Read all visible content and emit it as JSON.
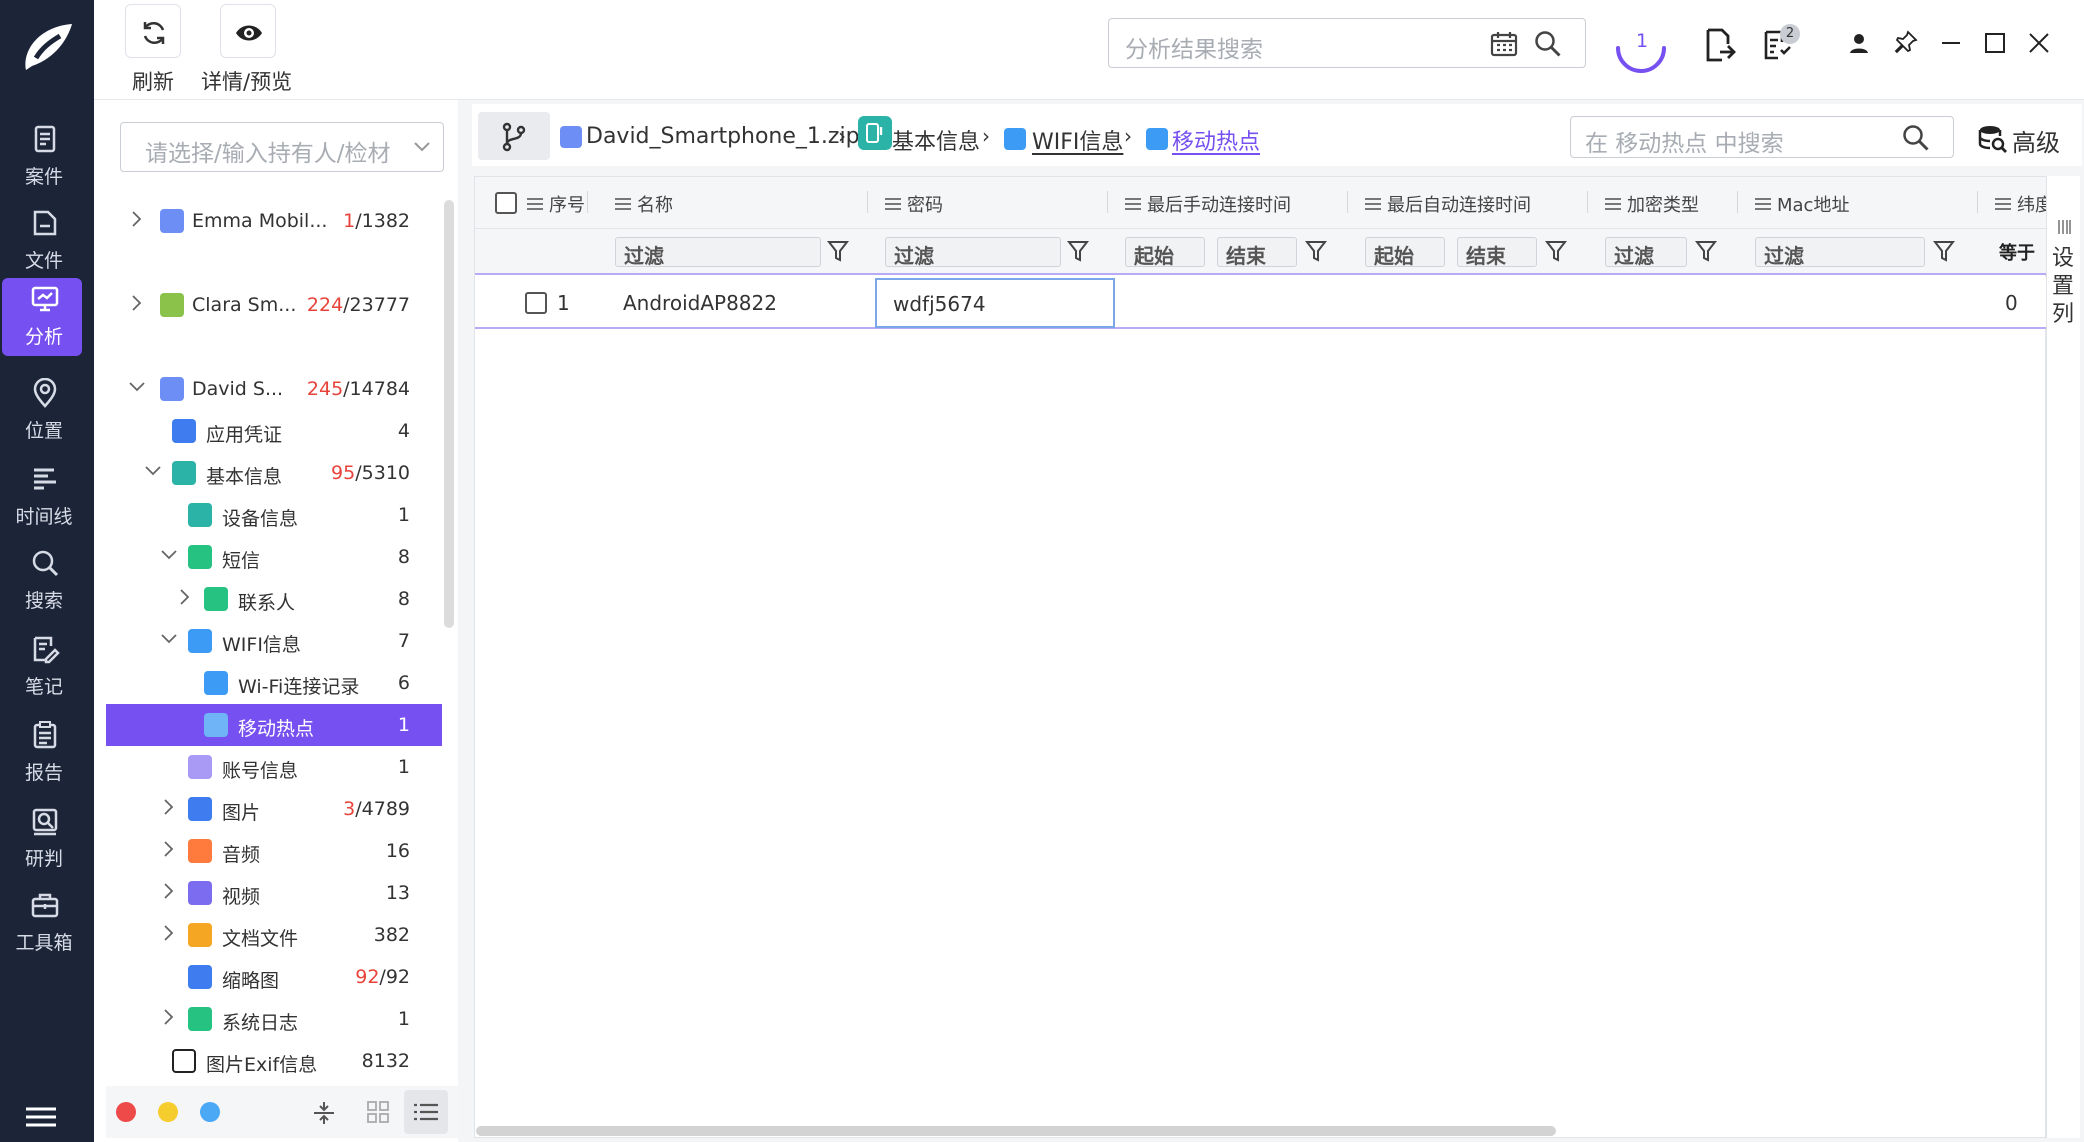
{
  "toolbar": {
    "refresh_label": "刷新",
    "details_label": "详情/预览",
    "search_placeholder": "分析结果搜索",
    "task_count": "1",
    "notify_count": "2"
  },
  "nav": {
    "items": [
      {
        "label": "案件",
        "icon": "case-icon"
      },
      {
        "label": "文件",
        "icon": "folder-icon"
      },
      {
        "label": "分析",
        "icon": "analysis-icon",
        "active": true
      },
      {
        "label": "位置",
        "icon": "location-icon"
      },
      {
        "label": "时间线",
        "icon": "timeline-icon"
      },
      {
        "label": "搜索",
        "icon": "search-icon"
      },
      {
        "label": "笔记",
        "icon": "note-icon"
      },
      {
        "label": "报告",
        "icon": "report-icon"
      },
      {
        "label": "研判",
        "icon": "judge-icon"
      },
      {
        "label": "工具箱",
        "icon": "toolbox-icon"
      }
    ]
  },
  "left": {
    "select_placeholder": "请选择/输入持有人/检材",
    "tree": [
      {
        "label": "Emma Mobil...",
        "red": "1",
        "count": "/1382"
      },
      {
        "label": "Clara Sm...",
        "red": "224",
        "count": "/23777"
      },
      {
        "label": "David S...",
        "red": "245",
        "count": "/14784"
      },
      {
        "label": "应用凭证",
        "red": "",
        "count": "4"
      },
      {
        "label": "基本信息",
        "red": "95",
        "count": "/5310"
      },
      {
        "label": "设备信息",
        "red": "",
        "count": "1"
      },
      {
        "label": "短信",
        "red": "",
        "count": "8"
      },
      {
        "label": "联系人",
        "red": "",
        "count": "8"
      },
      {
        "label": "WIFI信息",
        "red": "",
        "count": "7"
      },
      {
        "label": "Wi-Fi连接记录",
        "red": "",
        "count": "6"
      },
      {
        "label": "移动热点",
        "red": "",
        "count": "1"
      },
      {
        "label": "账号信息",
        "red": "",
        "count": "1"
      },
      {
        "label": "图片",
        "red": "3",
        "count": "/4789"
      },
      {
        "label": "音频",
        "red": "",
        "count": "16"
      },
      {
        "label": "视频",
        "red": "",
        "count": "13"
      },
      {
        "label": "文档文件",
        "red": "",
        "count": "382"
      },
      {
        "label": "缩略图",
        "red": "92",
        "count": "/92"
      },
      {
        "label": "系统日志",
        "red": "",
        "count": "1"
      },
      {
        "label": "图片Exif信息",
        "red": "",
        "count": "8132"
      }
    ]
  },
  "breadcrumb": {
    "file": "David_Smartphone_1.zip",
    "level1": "基本信息",
    "level2": "WIFI信息",
    "level3": "移动热点"
  },
  "grid_search": {
    "placeholder": "在 移动热点 中搜索",
    "advanced_label": "高级"
  },
  "table": {
    "columns": [
      "序号",
      "名称",
      "密码",
      "最后手动连接时间",
      "最后自动连接时间",
      "加密类型",
      "Mac地址",
      "纬度"
    ],
    "filter_label": "过滤",
    "start_label": "起始",
    "end_label": "结束",
    "equals_label": "等于",
    "rows": [
      {
        "index": "1",
        "name": "AndroidAP8822",
        "password": "wdfj5674",
        "latitude": "0"
      }
    ]
  },
  "column_settings": [
    "设",
    "置",
    "列"
  ],
  "colors": {
    "accent": "#7650f0",
    "nav_bg": "#1c2538",
    "red": "#e8433b"
  }
}
